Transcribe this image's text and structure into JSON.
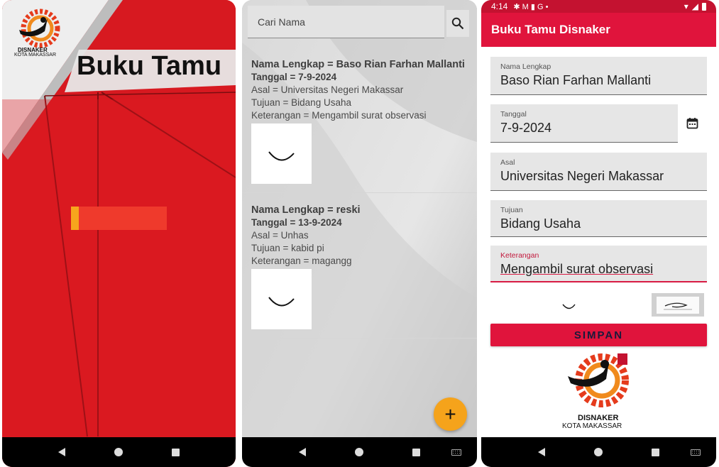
{
  "splash": {
    "title": "Buku Tamu",
    "logo_line1": "DISNAKER",
    "logo_line2": "KOTA MAKASSAR",
    "progress": 0.08,
    "colors": {
      "background": "#d91b22",
      "progress_track": "#ef3a2c",
      "progress_fill": "#f7a51d"
    }
  },
  "list": {
    "search_placeholder": "Cari Nama",
    "search_icon": "search-icon",
    "entries": [
      {
        "name": "Nama Lengkap = Baso Rian Farhan Mallanti",
        "date": "Tanggal = 7-9-2024",
        "origin": "Asal = Universitas Negeri Makassar",
        "purpose": "Tujuan = Bidang Usaha",
        "note": "Keterangan = Mengambil surat observasi"
      },
      {
        "name": "Nama Lengkap = reski",
        "date": "Tanggal = 13-9-2024",
        "origin": "Asal = Unhas",
        "purpose": "Tujuan = kabid pi",
        "note": "Keterangan = magangg"
      }
    ],
    "fab_icon": "add-icon",
    "colors": {
      "fab": "#f5a31b"
    }
  },
  "form": {
    "status": {
      "time": "4:14"
    },
    "appbar_title": "Buku Tamu Disnaker",
    "fields": {
      "nama": {
        "label": "Nama Lengkap",
        "value": "Baso Rian Farhan Mallanti"
      },
      "tanggal": {
        "label": "Tanggal",
        "value": "7-9-2024"
      },
      "asal": {
        "label": "Asal",
        "value": "Universitas Negeri Makassar"
      },
      "tujuan": {
        "label": "Tujuan",
        "value": "Bidang Usaha"
      },
      "keterangan": {
        "label": "Keterangan",
        "value": "Mengambil surat observasi"
      }
    },
    "save_label": "SIMPAN",
    "logo_line1": "DISNAKER",
    "logo_line2": "KOTA MAKASSAR",
    "colors": {
      "appbar": "#e0143c",
      "statusbar": "#c41230",
      "accent": "#d81b43"
    }
  }
}
